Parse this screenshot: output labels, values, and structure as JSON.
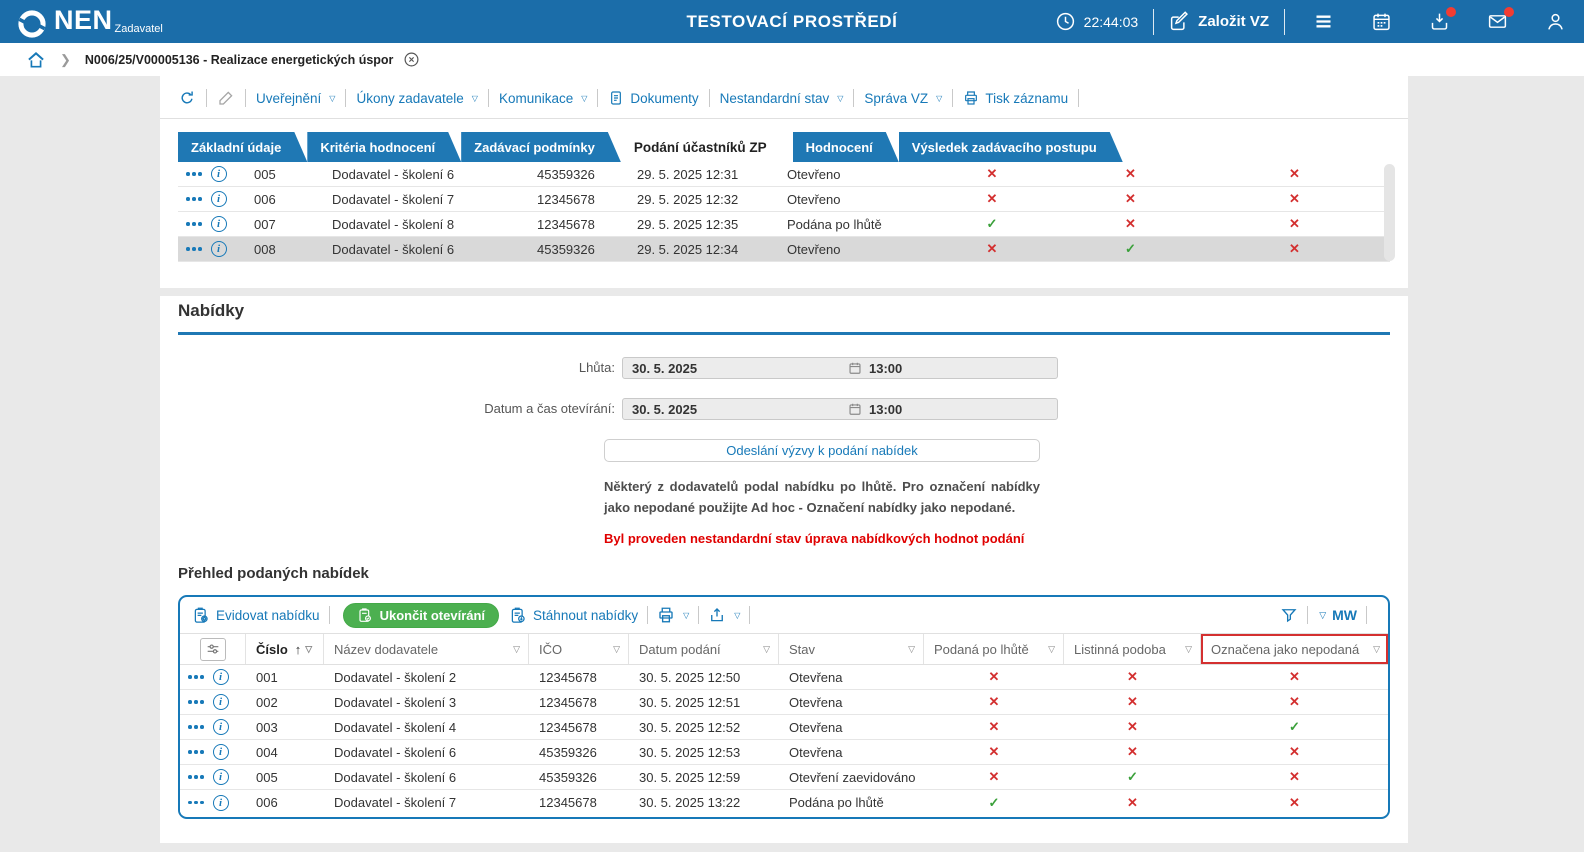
{
  "colors": {
    "accent_blue": "#1779b8",
    "header_blue": "#1b6da9",
    "tab_blue": "#1f78b4",
    "green": "#4cb050",
    "flag_red": "#d32f2f",
    "flag_green": "#3aa03a",
    "warning_red": "#e00000",
    "badge_red": "#f23c32"
  },
  "app": {
    "brand": "NEN",
    "brand_sub": "Zadavatel",
    "env_title": "TESTOVACÍ PROSTŘEDÍ",
    "clock": "22:44:03",
    "create_button": "Založit VZ"
  },
  "breadcrumb": {
    "item": "N006/25/V00005136 - Realizace energetických úspor"
  },
  "record_toolbar": {
    "uverejneni": "Uveřejnění",
    "ukony": "Úkony zadavatele",
    "komunikace": "Komunikace",
    "dokumenty": "Dokumenty",
    "nestandardni": "Nestandardní stav",
    "sprava": "Správa VZ",
    "tisk": "Tisk záznamu"
  },
  "tabs": [
    {
      "label": "Základní údaje"
    },
    {
      "label": "Kritéria hodnocení"
    },
    {
      "label": "Zadávací podmínky"
    },
    {
      "label": "Podání účastníků ZP",
      "active": true
    },
    {
      "label": "Hodnocení"
    },
    {
      "label": "Výsledek zadávacího postupu"
    }
  ],
  "participants_table": {
    "rows": [
      {
        "cislo": "005",
        "nazev": "Dodavatel - školení 6",
        "ico": "45359326",
        "datum": "29. 5. 2025 12:31",
        "stav": "Otevřeno",
        "f1": false,
        "f2": false,
        "f3": false
      },
      {
        "cislo": "006",
        "nazev": "Dodavatel - školení 7",
        "ico": "12345678",
        "datum": "29. 5. 2025 12:32",
        "stav": "Otevřeno",
        "f1": false,
        "f2": false,
        "f3": false
      },
      {
        "cislo": "007",
        "nazev": "Dodavatel - školení 8",
        "ico": "12345678",
        "datum": "29. 5. 2025 12:35",
        "stav": "Podána po lhůtě",
        "f1": true,
        "f2": false,
        "f3": false
      },
      {
        "cislo": "008",
        "nazev": "Dodavatel - školení 6",
        "ico": "45359326",
        "datum": "29. 5. 2025 12:34",
        "stav": "Otevřeno",
        "f1": false,
        "f2": true,
        "f3": false,
        "selected": true
      }
    ]
  },
  "offers_section": {
    "title": "Nabídky",
    "deadline_label": "Lhůta:",
    "deadline_date": "30. 5. 2025",
    "deadline_time": "13:00",
    "opening_label": "Datum a čas otevírání:",
    "opening_date": "30. 5. 2025",
    "opening_time": "13:00",
    "send_invite_button": "Odeslání výzvy k podání nabídek",
    "late_note": "Některý z dodavatelů podal nabídku po lhůtě. Pro označení nabídky jako nepodané použijte Ad hoc - Označení nabídky jako nepodané.",
    "nonstandard_warning": "Byl proveden nestandardní stav úprava nabídkových hodnot podání"
  },
  "offers_overview": {
    "title": "Přehled podaných nabídek",
    "toolbar": {
      "evidovat": "Evidovat nabídku",
      "ukoncit": "Ukončit otevírání",
      "stahnout": "Stáhnout nabídky",
      "view_label": "MW"
    },
    "columns": {
      "cislo": "Číslo",
      "nazev": "Název dodavatele",
      "ico": "IČO",
      "datum": "Datum podání",
      "stav": "Stav",
      "po_lhute": "Podaná po lhůtě",
      "listinna": "Listinná podoba",
      "nepodana": "Označena jako nepodaná"
    },
    "rows": [
      {
        "cislo": "001",
        "nazev": "Dodavatel - školení 2",
        "ico": "12345678",
        "datum": "30. 5. 2025 12:50",
        "stav": "Otevřena",
        "f1": false,
        "f2": false,
        "f3": false
      },
      {
        "cislo": "002",
        "nazev": "Dodavatel - školení 3",
        "ico": "12345678",
        "datum": "30. 5. 2025 12:51",
        "stav": "Otevřena",
        "f1": false,
        "f2": false,
        "f3": false
      },
      {
        "cislo": "003",
        "nazev": "Dodavatel - školení 4",
        "ico": "12345678",
        "datum": "30. 5. 2025 12:52",
        "stav": "Otevřena",
        "f1": false,
        "f2": false,
        "f3": true
      },
      {
        "cislo": "004",
        "nazev": "Dodavatel - školení 6",
        "ico": "45359326",
        "datum": "30. 5. 2025 12:53",
        "stav": "Otevřena",
        "f1": false,
        "f2": false,
        "f3": false
      },
      {
        "cislo": "005",
        "nazev": "Dodavatel - školení 6",
        "ico": "45359326",
        "datum": "30. 5. 2025 12:59",
        "stav": "Otevření zaevidováno",
        "f1": false,
        "f2": true,
        "f3": false
      },
      {
        "cislo": "006",
        "nazev": "Dodavatel - školení 7",
        "ico": "12345678",
        "datum": "30. 5. 2025 13:22",
        "stav": "Podána po lhůtě",
        "f1": true,
        "f2": false,
        "f3": false
      }
    ]
  }
}
